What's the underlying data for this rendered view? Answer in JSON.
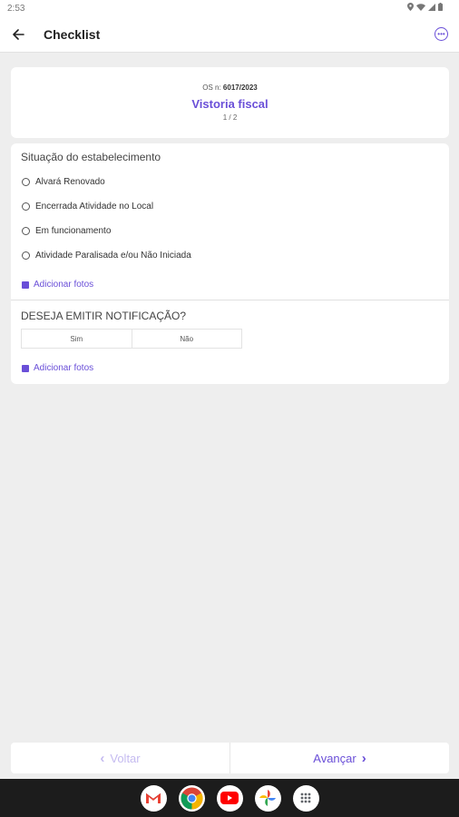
{
  "status_bar": {
    "time": "2:53"
  },
  "app_bar": {
    "title": "Checklist"
  },
  "header": {
    "os_label": "OS n:",
    "os_number": "6017/2023",
    "title": "Vistoria fiscal",
    "page_indicator": "1 / 2"
  },
  "section1": {
    "title": "Situação do estabelecimento",
    "options": [
      "Alvará Renovado",
      "Encerrada Atividade no Local",
      "Em funcionamento",
      "Atividade Paralisada e/ou Não Iniciada"
    ],
    "add_photos_label": "Adicionar fotos"
  },
  "section2": {
    "title": "DESEJA EMITIR NOTIFICAÇÃO?",
    "choices": [
      "Sim",
      "Não"
    ],
    "add_photos_label": "Adicionar fotos"
  },
  "bottom_nav": {
    "prev_label": "Voltar",
    "next_label": "Avançar"
  },
  "taskbar": {
    "apps": [
      "gmail-icon",
      "chrome-icon",
      "youtube-icon",
      "photos-icon",
      "app-drawer-icon"
    ]
  },
  "colors": {
    "accent": "#6a4fd8",
    "accent_disabled": "#c5bbf0",
    "background": "#eeeeee",
    "card": "#ffffff"
  }
}
